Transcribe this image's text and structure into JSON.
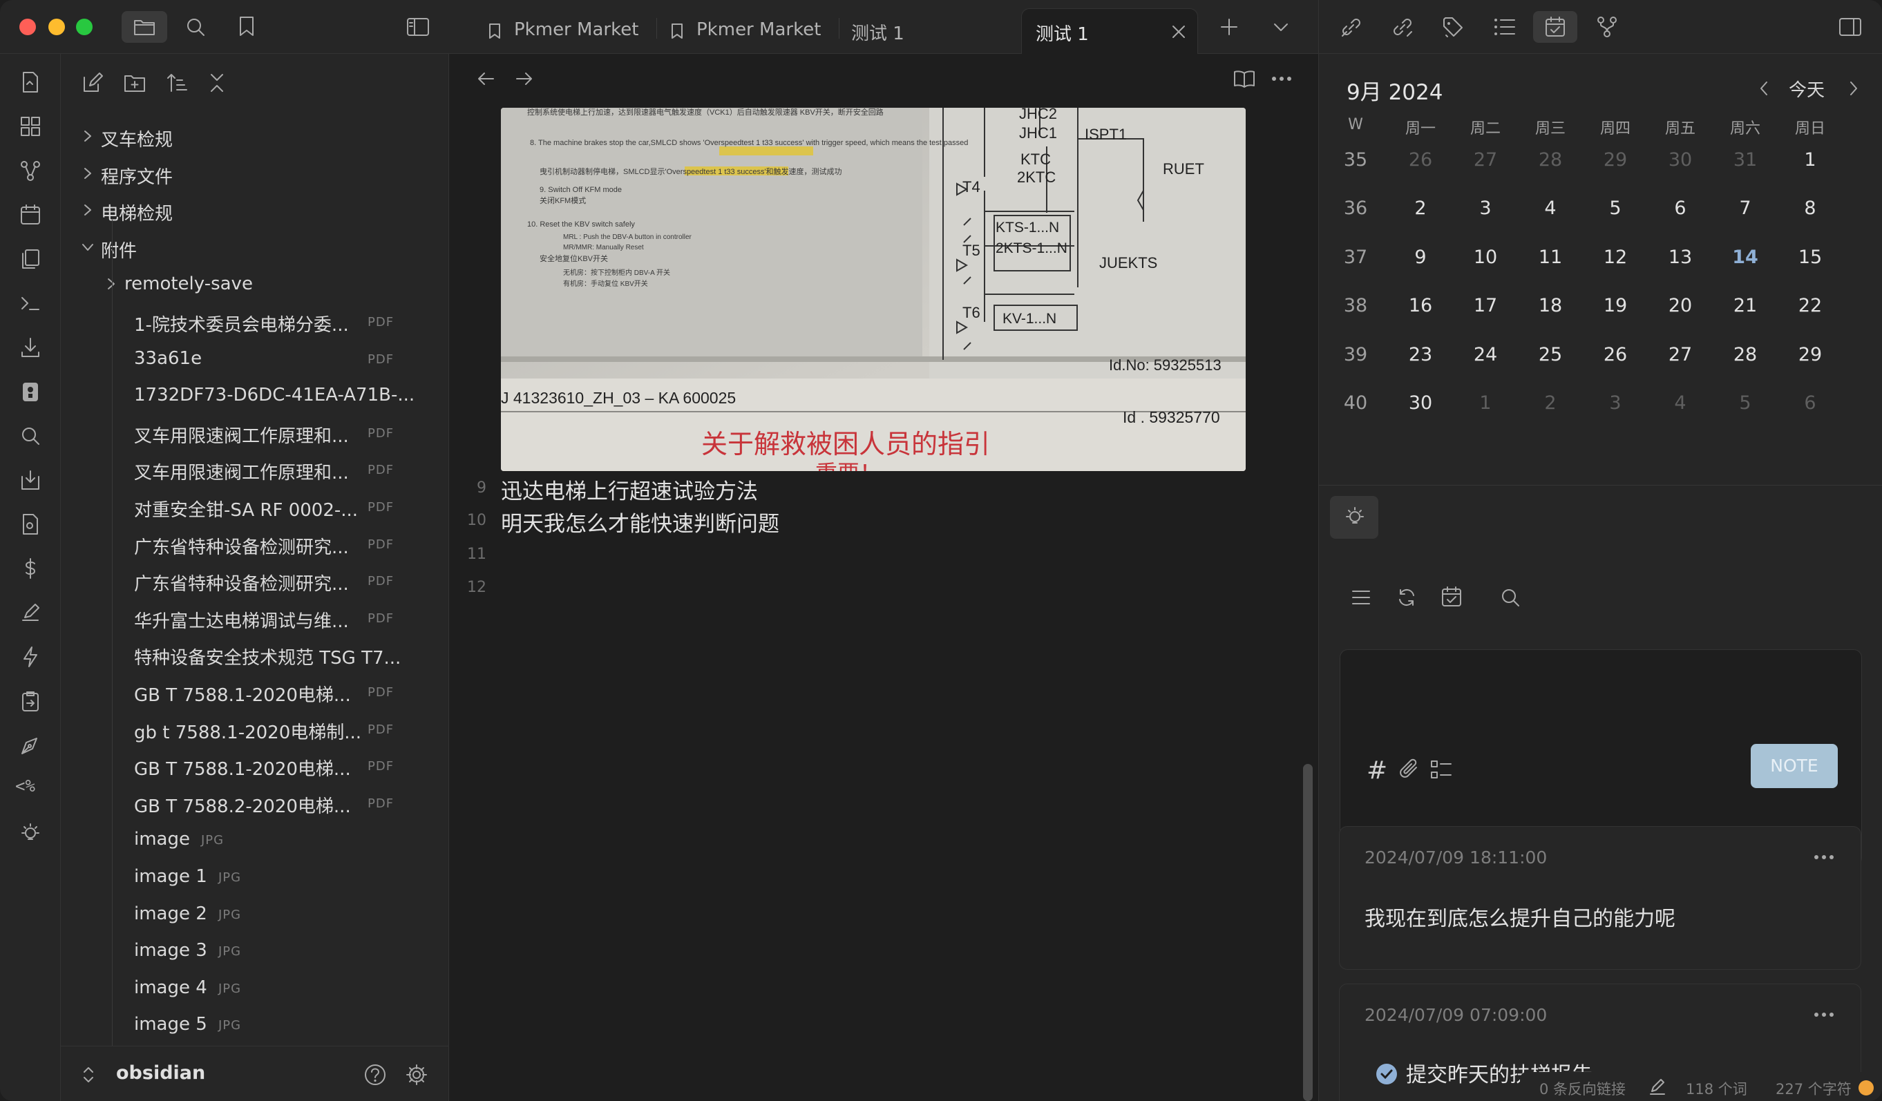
{
  "tabs": [
    {
      "label": "Pkmer Market"
    },
    {
      "label": "Pkmer Market"
    },
    {
      "label": "测试 1"
    },
    {
      "label": "测试 1"
    }
  ],
  "explorer": {
    "items": [
      {
        "label": "叉车检规",
        "type": "folder",
        "ext": ""
      },
      {
        "label": "程序文件",
        "type": "folder",
        "ext": ""
      },
      {
        "label": "电梯检规",
        "type": "folder",
        "ext": ""
      },
      {
        "label": "附件",
        "type": "folder-open",
        "ext": ""
      },
      {
        "label": "remotely-save",
        "type": "folder",
        "ext": ""
      },
      {
        "label": "1-院技术委员会电梯分委...",
        "type": "file",
        "ext": "PDF"
      },
      {
        "label": "33a61e",
        "type": "file",
        "ext": "PDF"
      },
      {
        "label": "1732DF73-D6DC-41EA-A71B-...",
        "type": "file",
        "ext": ""
      },
      {
        "label": "叉车用限速阀工作原理和...",
        "type": "file",
        "ext": "PDF"
      },
      {
        "label": "叉车用限速阀工作原理和...",
        "type": "file",
        "ext": "PDF"
      },
      {
        "label": "对重安全钳-SA RF 0002-...",
        "type": "file",
        "ext": "PDF"
      },
      {
        "label": "广东省特种设备检测研究...",
        "type": "file",
        "ext": "PDF"
      },
      {
        "label": "广东省特种设备检测研究...",
        "type": "file",
        "ext": "PDF"
      },
      {
        "label": "华升富士达电梯调试与维...",
        "type": "file",
        "ext": "PDF"
      },
      {
        "label": "特种设备安全技术规范 TSG T7...",
        "type": "file",
        "ext": ""
      },
      {
        "label": "GB T 7588.1-2020电梯...",
        "type": "file",
        "ext": "PDF"
      },
      {
        "label": "gb t 7588.1-2020电梯制...",
        "type": "file",
        "ext": "PDF"
      },
      {
        "label": "GB T 7588.1-2020电梯...",
        "type": "file",
        "ext": "PDF"
      },
      {
        "label": "GB T 7588.2-2020电梯...",
        "type": "file",
        "ext": "PDF"
      },
      {
        "label": "image",
        "type": "file",
        "ext": "JPG"
      },
      {
        "label": "image 1",
        "type": "file",
        "ext": "JPG"
      },
      {
        "label": "image 2",
        "type": "file",
        "ext": "JPG"
      },
      {
        "label": "image 3",
        "type": "file",
        "ext": "JPG"
      },
      {
        "label": "image 4",
        "type": "file",
        "ext": "JPG"
      },
      {
        "label": "image 5",
        "type": "file",
        "ext": "JPG"
      }
    ]
  },
  "vault": {
    "name": "obsidian"
  },
  "editor": {
    "lines": [
      {
        "num": "9",
        "text": "迅达电梯上行超速试验方法"
      },
      {
        "num": "10",
        "text": "明天我怎么才能快速判断问题"
      },
      {
        "num": "11",
        "text": ""
      },
      {
        "num": "12",
        "text": ""
      }
    ],
    "image": {
      "lines": [
        "控制系统使电梯上行加速，达到限速器电气触发速度（VCK1）后自动触发限速器 KBV开关，断开安全回路",
        "8. The machine brakes stop the car,SMLCD shows 'Overspeedtest 1 t33 success' with trigger speed, which means the test passed",
        "曳引机制动器制停电梯，SMLCD显示'Overspeedtest 1 t33 success'和触发速度，测试成功",
        "9. Switch Off KFM mode",
        "关闭KFM模式",
        "10. Reset the KBV switch safely",
        "MRL : Push the DBV-A button in controller",
        "MR/MMR: Manually Reset",
        "安全地复位KBV开关",
        "无机房：按下控制柜内 DBV-A 开关",
        "有机房：手动复位 KBV开关"
      ],
      "labels": [
        "JHC2",
        "JHC1",
        "ISPT1",
        "KTC",
        "2KTC",
        "RUET",
        "T4",
        "KTS-1...N",
        "2KTS-1...N",
        "T5",
        "JUEKTS",
        "T6",
        "KV-1...N"
      ],
      "id_top": "Id.No: 59325513",
      "part_number": "J 41323610_ZH_03 – KA 600025",
      "id_bottom": "Id . 59325770",
      "banner": "关于解救被困人员的指引",
      "banner_sub": "重要！"
    },
    "status": {
      "backlinks": "0 条反向链接",
      "words": "118 个词",
      "chars": "227 个字符"
    }
  },
  "calendar": {
    "month_title": "9月 2024",
    "today_label": "今天",
    "headers": [
      "W",
      "周一",
      "周二",
      "周三",
      "周四",
      "周五",
      "周六",
      "周日"
    ],
    "weeks": [
      {
        "w": "35",
        "days": [
          "26",
          "27",
          "28",
          "29",
          "30",
          "31",
          "1"
        ]
      },
      {
        "w": "36",
        "days": [
          "2",
          "3",
          "4",
          "5",
          "6",
          "7",
          "8"
        ]
      },
      {
        "w": "37",
        "days": [
          "9",
          "10",
          "11",
          "12",
          "13",
          "14",
          "15"
        ]
      },
      {
        "w": "38",
        "days": [
          "16",
          "17",
          "18",
          "19",
          "20",
          "21",
          "22"
        ]
      },
      {
        "w": "39",
        "days": [
          "23",
          "24",
          "25",
          "26",
          "27",
          "28",
          "29"
        ]
      },
      {
        "w": "40",
        "days": [
          "30",
          "1",
          "2",
          "3",
          "4",
          "5",
          "6"
        ]
      }
    ],
    "today": "14"
  },
  "memos": {
    "note_button": "NOTE",
    "items": [
      {
        "time": "2024/07/09 18:11:00",
        "text": "我现在到底怎么提升自己的能力呢"
      },
      {
        "time": "2024/07/09 07:09:00",
        "text": "提交昨天的扶梯报告"
      }
    ]
  },
  "colors": {
    "accent": "#7aa2c8",
    "today": "#8fb0d6",
    "note_button_bg": "#a8c3d6",
    "highlight": "#e0c43a",
    "banner_red": "#c8343a"
  }
}
